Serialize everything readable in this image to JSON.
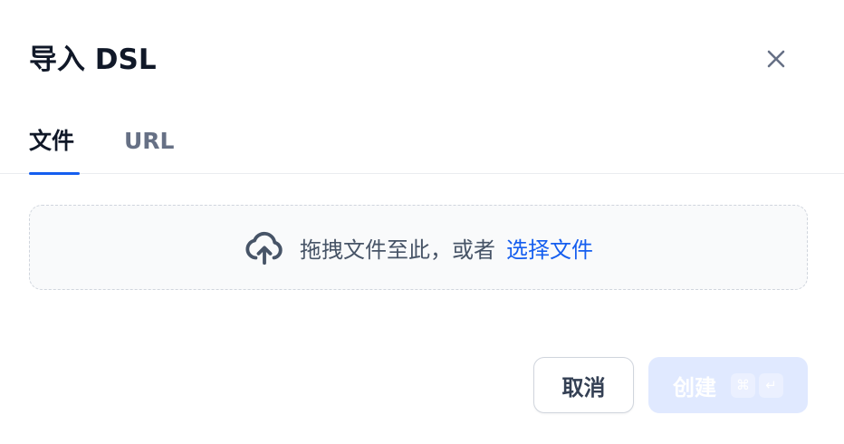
{
  "dialog": {
    "title": "导入 DSL"
  },
  "tabs": [
    {
      "label": "文件",
      "active": true
    },
    {
      "label": "URL",
      "active": false
    }
  ],
  "dropzone": {
    "icon": "upload-cloud-icon",
    "text": "拖拽文件至此，或者",
    "link_text": "选择文件"
  },
  "footer": {
    "cancel_label": "取消",
    "create_label": "创建",
    "shortcut_keys": [
      "⌘",
      "↵"
    ]
  },
  "colors": {
    "primary": "#155eef",
    "primary_disabled": "#e0e9ff",
    "text_primary": "#101828",
    "text_muted": "#667085",
    "dropzone_bg": "#f9fafb",
    "border": "#d0d5dd"
  }
}
